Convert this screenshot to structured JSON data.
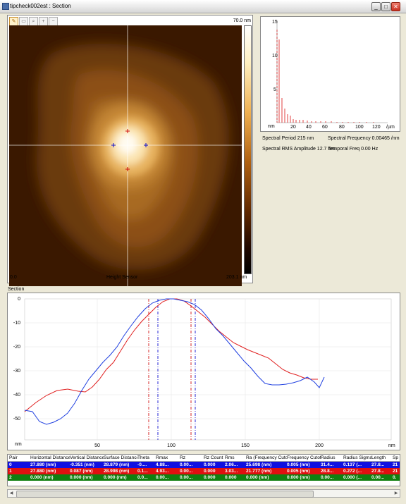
{
  "window": {
    "title": "tipcheck002est : Section"
  },
  "image": {
    "z_max": "70.0 nm",
    "x_start": "0.0",
    "x_label": "Height Sensor",
    "x_end": "203.1 nm"
  },
  "spectrum": {
    "y_ticks": [
      "15",
      "10",
      "5"
    ],
    "x_ticks": [
      "20",
      "40",
      "60",
      "80",
      "100",
      "120"
    ],
    "x_unit": "/µm",
    "y_unit": "nm",
    "spectral_period": "Spectral Period 215 nm",
    "spectral_frequency": "Spectral Frequency 0.00465 /nm",
    "spectral_rms": "Spectral RMS Amplitude 12.7 nm",
    "temporal_freq": "Temporal Freq 0.00 Hz"
  },
  "section": {
    "label": "Section",
    "y_ticks": [
      "0",
      "-10",
      "-20",
      "-30",
      "-40",
      "-50"
    ],
    "x_ticks": [
      "50",
      "100",
      "150",
      "200"
    ],
    "y_unit": "nm",
    "x_unit": "nm"
  },
  "table": {
    "headers": [
      "Pair",
      "Horizontal Distance",
      "Vertical Distance",
      "Surface Distance",
      "Theta",
      "Rmax",
      "Rz",
      "Rz Count",
      "Rms",
      "Ra (Frequency Cutoff)",
      "Frequency Cutoff",
      "Radius",
      "Radius Sigma",
      "Length",
      "Sp"
    ],
    "rows": [
      [
        "0",
        "27.880 (nm)",
        "-0.351 (nm)",
        "28.879 (nm)",
        "-0....",
        "4.88...",
        "0.00...",
        "0.000",
        "2.06...",
        "25.698 (nm)",
        "0.005 (nm)",
        "31.4...",
        "0.137 (...",
        "27.8...",
        "21"
      ],
      [
        "1",
        "27.880 (nm)",
        "0.087 (nm)",
        "28.998 (nm)",
        "0.1...",
        "4.93...",
        "0.00...",
        "0.000",
        "3.03...",
        "21.777 (nm)",
        "0.005 (nm)",
        "28.8...",
        "0.272 (...",
        "27.8...",
        "21"
      ],
      [
        "2",
        "0.000 (nm)",
        "0.000 (nm)",
        "0.000 (nm)",
        "0.0...",
        "0.00...",
        "0.00...",
        "0.000",
        "0.000",
        "0.000 (nm)",
        "0.000 (nm)",
        "0.00...",
        "0.000 (...",
        "0.00...",
        "0."
      ]
    ]
  }
}
